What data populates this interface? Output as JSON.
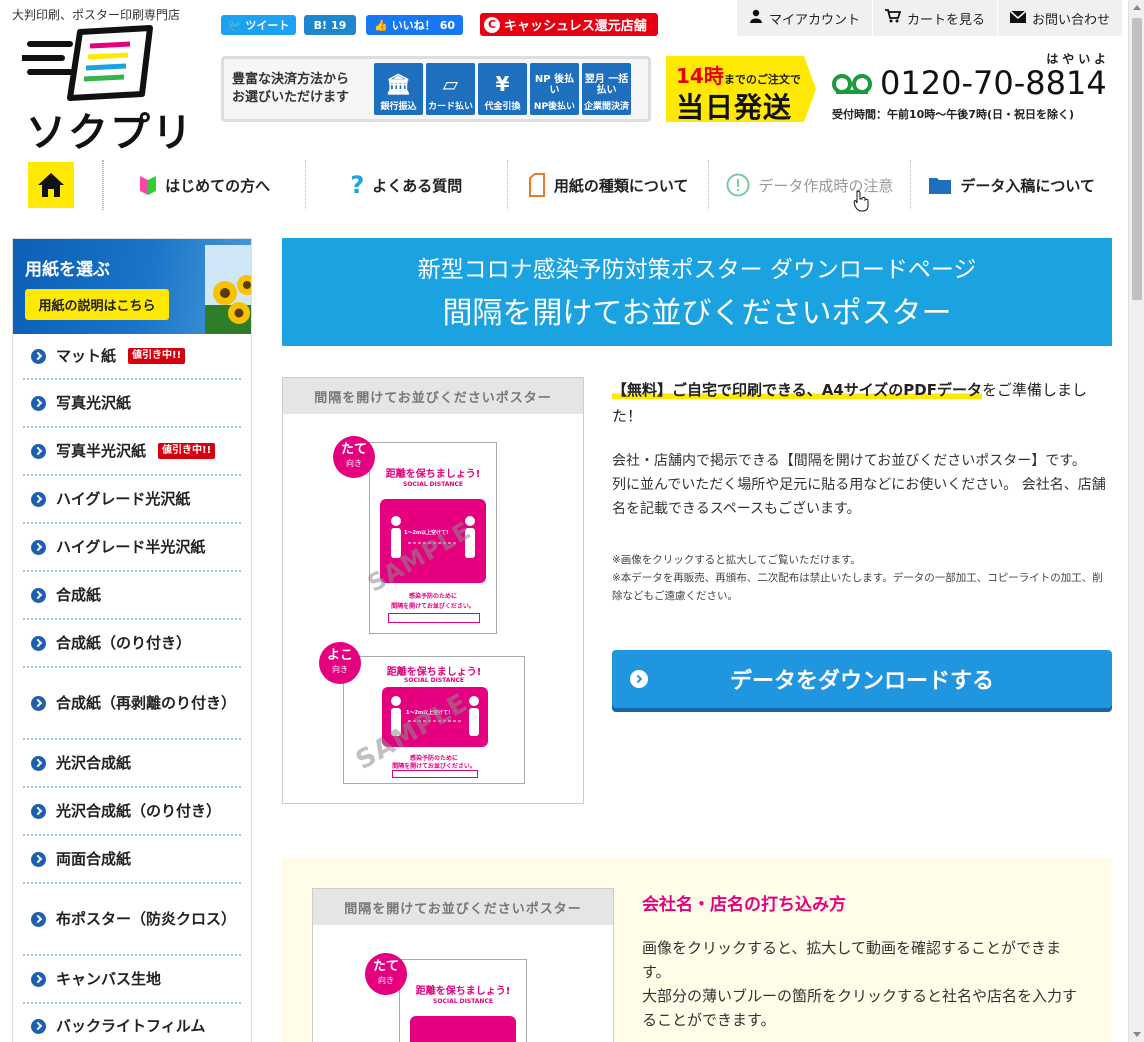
{
  "header": {
    "tagline": "大判印刷、ポスター印刷専門店",
    "logo_text": "ソクプリ",
    "social": {
      "tweet": "ツイート",
      "hatena": "B!",
      "hatena_count": "19",
      "like": "いいね！",
      "like_count": "60"
    },
    "cashless": "キャッシュレス還元店舗",
    "cashless_icon": "C",
    "topbar": {
      "account": "マイアカウント",
      "cart": "カートを見る",
      "contact": "お問い合わせ"
    },
    "payment": {
      "lead_line1": "豊富な決済方法から",
      "lead_line2": "お選びいただけます",
      "methods": [
        {
          "label": "銀行振込",
          "icon": "bank-icon",
          "sym": "🏛"
        },
        {
          "label": "カード払い",
          "icon": "card-icon",
          "sym": "▱"
        },
        {
          "label": "代金引換",
          "icon": "cod-icon",
          "sym": "¥"
        },
        {
          "label": "NP後払い",
          "icon": "np-icon",
          "sym": "NP 後払い"
        },
        {
          "label": "企業間決済",
          "icon": "monthly-icon",
          "sym": "翌月 一括払い"
        }
      ]
    },
    "shipping": {
      "hour": "14時",
      "line1": "までのご注文で",
      "line2": "当日発送"
    },
    "phone": {
      "ruby": "はやいよ",
      "number": "0120-70-8814",
      "hours": "受付時間：午前10時〜午後7時(日・祝日を除く)"
    }
  },
  "nav": {
    "items": [
      {
        "label": "はじめての方へ",
        "icon": "beginner-icon"
      },
      {
        "label": "よくある質問",
        "icon": "question-icon"
      },
      {
        "label": "用紙の種類について",
        "icon": "paper-icon"
      },
      {
        "label": "データ作成時の注意",
        "icon": "alert-icon"
      },
      {
        "label": "データ入稿について",
        "icon": "folder-icon"
      }
    ]
  },
  "sidebar": {
    "title": "用紙を選ぶ",
    "button": "用紙の説明はこちら",
    "sale_label": "値引き中!!",
    "items": [
      {
        "label": "マット紙",
        "sale": true
      },
      {
        "label": "写真光沢紙",
        "sale": false
      },
      {
        "label": "写真半光沢紙",
        "sale": true
      },
      {
        "label": "ハイグレード光沢紙",
        "sale": false
      },
      {
        "label": "ハイグレード半光沢紙",
        "sale": false
      },
      {
        "label": "合成紙",
        "sale": false
      },
      {
        "label": "合成紙（のり付き）",
        "sale": false
      },
      {
        "label": "合成紙（再剥離のり付き）",
        "sale": false
      },
      {
        "label": "光沢合成紙",
        "sale": false
      },
      {
        "label": "光沢合成紙（のり付き）",
        "sale": false
      },
      {
        "label": "両面合成紙",
        "sale": false
      },
      {
        "label": "布ポスター（防炎クロス）",
        "sale": false
      },
      {
        "label": "キャンバス生地",
        "sale": false
      },
      {
        "label": "バックライトフィルム",
        "sale": false
      }
    ]
  },
  "main": {
    "banner": {
      "line1": "新型コロナ感染予防対策ポスター ダウンロードページ",
      "line2": "間隔を開けてお並びくださいポスター"
    },
    "poster_card": {
      "title": "間隔を開けてお並びくださいポスター",
      "portrait_tag": "たて",
      "landscape_tag": "よこ",
      "tag_sub": "向き",
      "mini_head": "距離を保ちましょう!",
      "mini_sub": "SOCIAL DISTANCE",
      "mini_box_text": "1〜2m以上空けて!",
      "mini_foot1": "感染予防のために",
      "mini_foot2": "間隔を開けてお並びください。",
      "watermark": "SAMPLE"
    },
    "description": {
      "lead_highlight": "【無料】ご自宅で印刷できる、A4サイズのPDFデータ",
      "lead_rest": "をご準備しました！",
      "body1": "会社・店舗内で掲示できる【間隔を開けてお並びくださいポスター】です。",
      "body2": "列に並んでいただく場所や足元に貼る用などにお使いください。 会社名、店舗名を記載できるスペースもございます。",
      "note1": "※画像をクリックすると拡大してご覧いただけます。",
      "note2": "※本データを再販売、再頒布、二次配布は禁止いたします。データの一部加工、コピーライトの加工、削除などもご遠慮ください。"
    },
    "download_button": "データをダウンロードする",
    "howto": {
      "title": "会社名・店名の打ち込み方",
      "body1": "画像をクリックすると、拡大して動画を確認することができます。",
      "body2": "大部分の薄いブルーの箇所をクリックすると社名や店名を入力することができます。"
    }
  },
  "colors": {
    "brand_blue": "#1aa3e0",
    "accent_yellow": "#ffe900",
    "pink": "#e4007f",
    "sale_red": "#d7000f"
  }
}
